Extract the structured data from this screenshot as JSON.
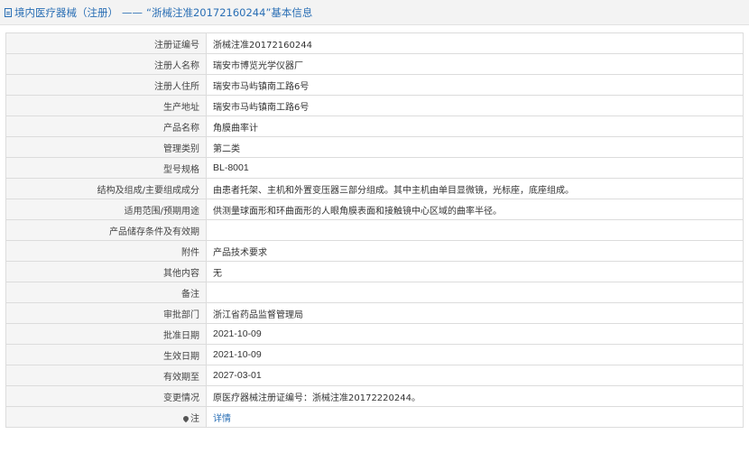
{
  "header": {
    "category": "境内医疗器械（注册）",
    "separator": "——",
    "title": "“浙械注准20172160244”基本信息"
  },
  "rows": [
    {
      "label": "注册证编号",
      "value": "浙械注准20172160244"
    },
    {
      "label": "注册人名称",
      "value": "瑞安市博览光学仪器厂"
    },
    {
      "label": "注册人住所",
      "value": "瑞安市马屿镇南工路6号"
    },
    {
      "label": "生产地址",
      "value": "瑞安市马屿镇南工路6号"
    },
    {
      "label": "产品名称",
      "value": "角膜曲率计"
    },
    {
      "label": "管理类别",
      "value": "第二类"
    },
    {
      "label": "型号规格",
      "value": "BL-8001"
    },
    {
      "label": "结构及组成/主要组成成分",
      "value": "由患者托架、主机和外置变压器三部分组成。其中主机由单目显微镜，光标座，底座组成。"
    },
    {
      "label": "适用范围/预期用途",
      "value": "供测量球面形和环曲面形的人眼角膜表面和接触镜中心区域的曲率半径。"
    },
    {
      "label": "产品储存条件及有效期",
      "value": ""
    },
    {
      "label": "附件",
      "value": "产品技术要求"
    },
    {
      "label": "其他内容",
      "value": "无"
    },
    {
      "label": "备注",
      "value": ""
    },
    {
      "label": "审批部门",
      "value": "浙江省药品监督管理局"
    },
    {
      "label": "批准日期",
      "value": "2021-10-09"
    },
    {
      "label": "生效日期",
      "value": "2021-10-09"
    },
    {
      "label": "有效期至",
      "value": "2027-03-01"
    },
    {
      "label": "变更情况",
      "value": "原医疗器械注册证编号：浙械注准20172220244。"
    }
  ],
  "note_row": {
    "label": "注",
    "link_text": "详情",
    "icon": "pin-icon"
  },
  "colors": {
    "link": "#2a6fb5",
    "label_bg": "#f5f5f5",
    "border": "#dcdcdc"
  }
}
